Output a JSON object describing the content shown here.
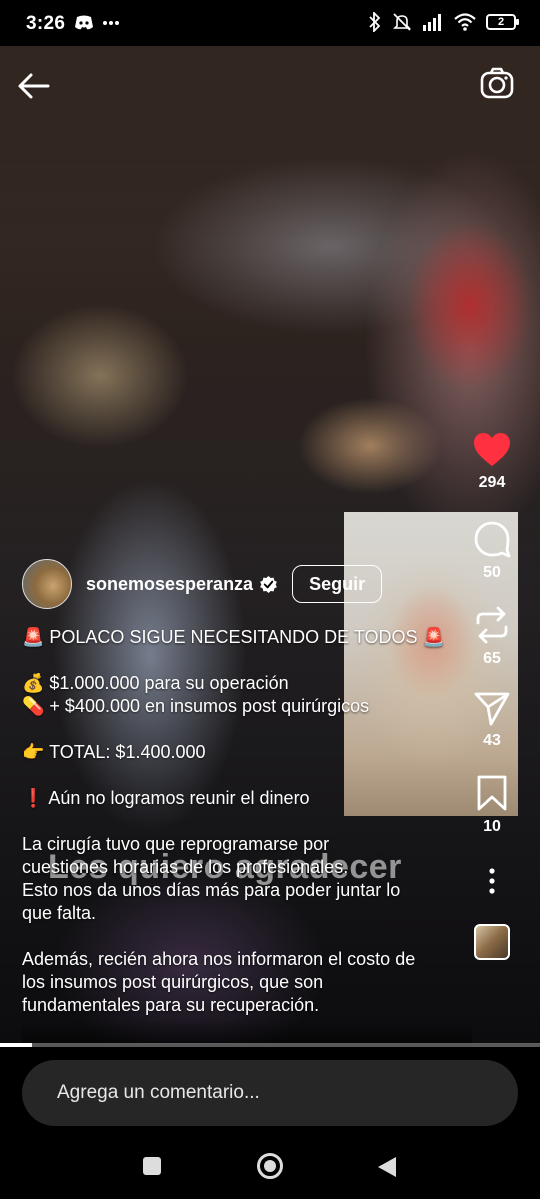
{
  "status_bar": {
    "time": "3:26",
    "left_icons": [
      "discord-icon",
      "more-dots-icon"
    ],
    "right_icons": [
      "bluetooth-icon",
      "mute-icon",
      "signal-icon",
      "wifi-icon",
      "battery-icon"
    ],
    "battery_level": "2"
  },
  "video": {
    "overlay_text": "Les quiero agradecer",
    "progress_fraction": 0.06
  },
  "top_bar": {
    "back_icon": "arrow-left-icon",
    "camera_icon": "camera-icon"
  },
  "actions": {
    "likes": "294",
    "comments": "50",
    "reposts": "65",
    "shares": "43",
    "saves": "10",
    "like_color": "#ff3040"
  },
  "post": {
    "username": "sonemosesperanza",
    "follow_label": "Seguir",
    "caption_lines": [
      "🚨 POLACO SIGUE NECESITANDO DE TODOS 🚨",
      "",
      "💰 $1.000.000 para su operación",
      "💊 + $400.000 en insumos post quirúrgicos",
      "",
      "👉 TOTAL: $1.400.000",
      "",
      "❗ Aún no logramos reunir el dinero",
      "",
      "La cirugía tuvo que reprogramarse por",
      "cuestiones horarias de los profesionales.",
      "Esto nos da unos días más para poder juntar lo",
      "que falta.",
      "",
      "Además, recién ahora nos informaron el costo de",
      "los insumos post quirúrgicos, que son",
      "fundamentales para su recuperación."
    ]
  },
  "comment": {
    "placeholder": "Agrega un comentario..."
  }
}
